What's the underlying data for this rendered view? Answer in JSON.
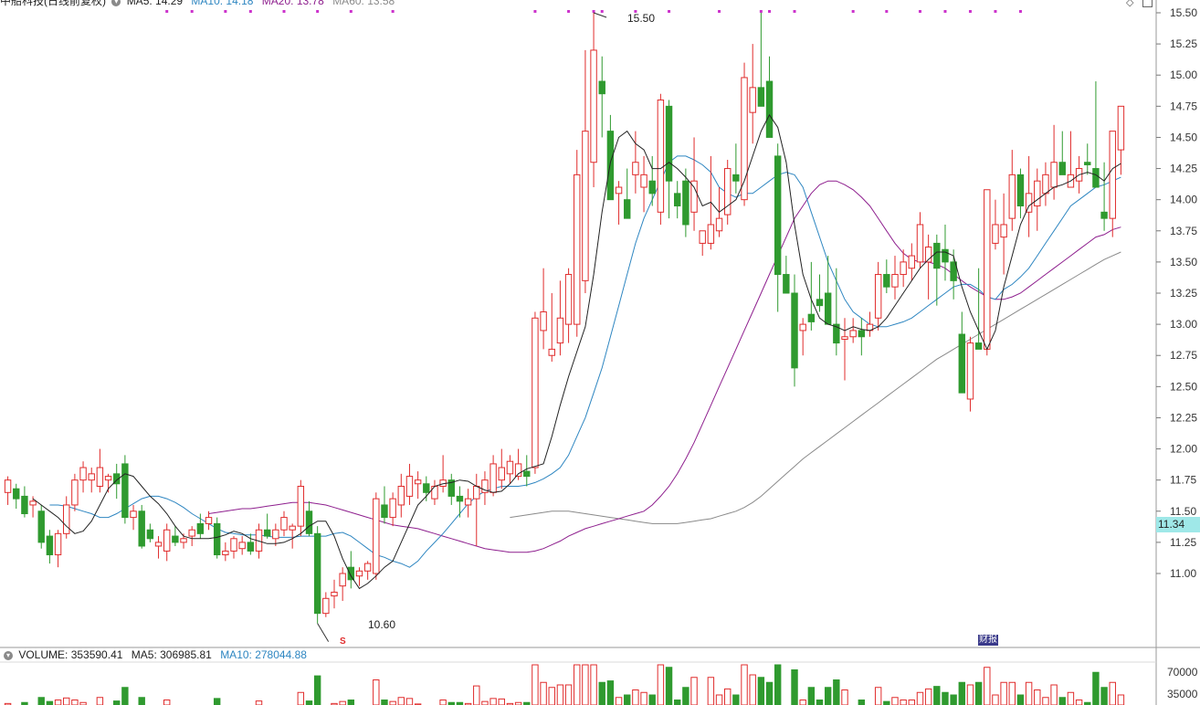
{
  "header": {
    "stock_title": "中船科技(日线前复权)",
    "ma5_label": "MA5: 14.29",
    "ma10_label": "MA10: 14.18",
    "ma20_label": "MA20: 13.78",
    "ma60_label": "MA60: 13.58"
  },
  "colors": {
    "up": "#e02c2c",
    "down": "#2f9a2f",
    "ma5": "#222222",
    "ma10": "#2e86c1",
    "ma20": "#8e1f8e",
    "ma60": "#8a8a8a",
    "marker": "#cc33cc",
    "price_badge_bg": "#9fe8e8"
  },
  "price_axis": {
    "ticks": [
      "15.50",
      "15.25",
      "15.00",
      "14.75",
      "14.50",
      "14.25",
      "14.00",
      "13.75",
      "13.50",
      "13.25",
      "13.00",
      "12.75",
      "12.50",
      "12.25",
      "12.00",
      "11.75",
      "11.50",
      "11.25",
      "11.00"
    ],
    "current_price": "11.34"
  },
  "annotations": {
    "high_label": "15.50",
    "low_label": "10.60",
    "event_marker_s": "S",
    "event_marker_cb": "财报"
  },
  "volume_panel": {
    "volume_label": "VOLUME: 353590.41",
    "ma5_label": "MA5: 306985.81",
    "ma10_label": "MA10: 278044.88",
    "ticks": [
      "70000",
      "35000"
    ]
  },
  "chart_data": {
    "type": "candlestick",
    "title": "中船科技(日线前复权)",
    "ylim": [
      10.4,
      15.62
    ],
    "ohlc": [
      [
        11.65,
        11.78,
        11.55,
        11.75
      ],
      [
        11.68,
        11.72,
        11.52,
        11.6
      ],
      [
        11.62,
        11.7,
        11.45,
        11.48
      ],
      [
        11.55,
        11.62,
        11.45,
        11.58
      ],
      [
        11.5,
        11.55,
        11.2,
        11.25
      ],
      [
        11.3,
        11.35,
        11.08,
        11.15
      ],
      [
        11.15,
        11.35,
        11.05,
        11.32
      ],
      [
        11.32,
        11.62,
        11.28,
        11.55
      ],
      [
        11.55,
        11.8,
        11.5,
        11.75
      ],
      [
        11.75,
        11.9,
        11.65,
        11.85
      ],
      [
        11.75,
        11.85,
        11.65,
        11.8
      ],
      [
        11.7,
        12.0,
        11.65,
        11.85
      ],
      [
        11.75,
        11.8,
        11.65,
        11.78
      ],
      [
        11.8,
        11.88,
        11.6,
        11.72
      ],
      [
        11.88,
        11.95,
        11.4,
        11.45
      ],
      [
        11.45,
        11.55,
        11.35,
        11.5
      ],
      [
        11.5,
        11.55,
        11.2,
        11.22
      ],
      [
        11.35,
        11.4,
        11.25,
        11.28
      ],
      [
        11.22,
        11.3,
        11.12,
        11.25
      ],
      [
        11.18,
        11.4,
        11.1,
        11.35
      ],
      [
        11.3,
        11.38,
        11.22,
        11.25
      ],
      [
        11.25,
        11.32,
        11.2,
        11.28
      ],
      [
        11.3,
        11.38,
        11.22,
        11.35
      ],
      [
        11.4,
        11.48,
        11.28,
        11.32
      ],
      [
        11.4,
        11.5,
        11.35,
        11.45
      ],
      [
        11.4,
        11.45,
        11.12,
        11.15
      ],
      [
        11.15,
        11.25,
        11.1,
        11.18
      ],
      [
        11.18,
        11.3,
        11.12,
        11.28
      ],
      [
        11.2,
        11.3,
        11.15,
        11.25
      ],
      [
        11.25,
        11.32,
        11.15,
        11.18
      ],
      [
        11.18,
        11.4,
        11.12,
        11.35
      ],
      [
        11.35,
        11.48,
        11.28,
        11.3
      ],
      [
        11.28,
        11.4,
        11.22,
        11.35
      ],
      [
        11.35,
        11.5,
        11.3,
        11.45
      ],
      [
        11.35,
        11.4,
        11.2,
        11.38
      ],
      [
        11.38,
        11.75,
        11.3,
        11.7
      ],
      [
        11.5,
        11.58,
        11.3,
        11.32
      ],
      [
        11.32,
        11.38,
        10.6,
        10.68
      ],
      [
        10.68,
        10.85,
        10.65,
        10.8
      ],
      [
        10.82,
        10.95,
        10.72,
        10.85
      ],
      [
        10.9,
        11.05,
        10.78,
        11.0
      ],
      [
        11.05,
        11.18,
        10.88,
        10.95
      ],
      [
        10.98,
        11.05,
        10.9,
        11.02
      ],
      [
        11.02,
        11.1,
        10.95,
        11.08
      ],
      [
        11.0,
        11.65,
        10.95,
        11.6
      ],
      [
        11.55,
        11.7,
        11.4,
        11.45
      ],
      [
        11.45,
        11.65,
        11.38,
        11.6
      ],
      [
        11.55,
        11.8,
        11.45,
        11.7
      ],
      [
        11.62,
        11.88,
        11.55,
        11.78
      ],
      [
        11.72,
        11.82,
        11.6,
        11.75
      ],
      [
        11.72,
        11.78,
        11.58,
        11.65
      ],
      [
        11.6,
        11.75,
        11.55,
        11.7
      ],
      [
        11.7,
        11.95,
        11.65,
        11.75
      ],
      [
        11.75,
        11.8,
        11.55,
        11.62
      ],
      [
        11.62,
        11.7,
        11.45,
        11.58
      ],
      [
        11.55,
        11.68,
        11.45,
        11.6
      ],
      [
        11.6,
        11.8,
        11.22,
        11.7
      ],
      [
        11.65,
        11.82,
        11.55,
        11.75
      ],
      [
        11.65,
        11.95,
        11.62,
        11.88
      ],
      [
        11.75,
        12.0,
        11.68,
        11.85
      ],
      [
        11.8,
        11.95,
        11.72,
        11.9
      ],
      [
        11.78,
        12.0,
        11.75,
        11.88
      ],
      [
        11.82,
        11.95,
        11.7,
        11.78
      ],
      [
        11.85,
        13.1,
        11.8,
        13.05
      ],
      [
        12.95,
        13.45,
        12.8,
        13.1
      ],
      [
        12.75,
        13.25,
        12.7,
        12.8
      ],
      [
        12.85,
        13.35,
        12.75,
        13.05
      ],
      [
        13.0,
        13.45,
        12.85,
        13.4
      ],
      [
        13.0,
        14.4,
        12.9,
        14.2
      ],
      [
        13.35,
        15.2,
        13.25,
        14.55
      ],
      [
        14.3,
        15.5,
        14.1,
        15.2
      ],
      [
        14.95,
        15.15,
        14.5,
        14.85
      ],
      [
        14.55,
        14.68,
        14.0,
        14.0
      ],
      [
        14.05,
        14.15,
        13.8,
        14.1
      ],
      [
        14.0,
        14.25,
        13.85,
        13.85
      ],
      [
        14.2,
        14.55,
        14.05,
        14.3
      ],
      [
        14.1,
        14.35,
        13.9,
        14.2
      ],
      [
        14.15,
        14.35,
        13.95,
        14.05
      ],
      [
        13.9,
        14.85,
        13.8,
        14.8
      ],
      [
        14.75,
        14.8,
        13.85,
        14.15
      ],
      [
        14.05,
        14.15,
        13.85,
        13.95
      ],
      [
        14.15,
        14.25,
        13.7,
        13.8
      ],
      [
        13.9,
        14.5,
        13.75,
        14.15
      ],
      [
        13.65,
        13.75,
        13.55,
        13.75
      ],
      [
        13.65,
        14.35,
        13.6,
        13.8
      ],
      [
        13.75,
        14.1,
        13.7,
        13.85
      ],
      [
        13.88,
        14.32,
        13.8,
        14.25
      ],
      [
        14.2,
        14.45,
        14.05,
        14.15
      ],
      [
        14.0,
        15.1,
        13.95,
        14.98
      ],
      [
        14.7,
        15.25,
        14.45,
        14.9
      ],
      [
        14.9,
        15.5,
        14.75,
        14.75
      ],
      [
        14.95,
        15.15,
        14.5,
        14.5
      ],
      [
        14.35,
        14.45,
        13.1,
        13.4
      ],
      [
        13.4,
        13.55,
        13.35,
        13.25
      ],
      [
        13.25,
        13.4,
        12.5,
        12.65
      ],
      [
        12.95,
        13.05,
        12.75,
        13.0
      ],
      [
        13.08,
        13.5,
        12.95,
        13.02
      ],
      [
        13.2,
        13.4,
        13.1,
        13.15
      ],
      [
        13.25,
        13.55,
        13.0,
        13.0
      ],
      [
        13.0,
        13.45,
        12.75,
        12.85
      ],
      [
        12.88,
        13.05,
        12.55,
        12.9
      ],
      [
        12.9,
        13.05,
        12.85,
        12.95
      ],
      [
        12.95,
        13.05,
        12.75,
        12.9
      ],
      [
        12.95,
        13.1,
        12.9,
        13.0
      ],
      [
        13.05,
        13.5,
        12.95,
        13.4
      ],
      [
        13.4,
        13.52,
        13.25,
        13.3
      ],
      [
        13.3,
        13.55,
        13.2,
        13.4
      ],
      [
        13.4,
        13.6,
        13.3,
        13.5
      ],
      [
        13.45,
        13.65,
        13.35,
        13.55
      ],
      [
        13.5,
        13.9,
        13.45,
        13.8
      ],
      [
        13.5,
        13.72,
        13.2,
        13.62
      ],
      [
        13.65,
        13.72,
        13.15,
        13.45
      ],
      [
        13.6,
        13.8,
        13.35,
        13.5
      ],
      [
        13.5,
        13.6,
        13.2,
        13.35
      ],
      [
        12.92,
        13.1,
        12.45,
        12.45
      ],
      [
        12.4,
        12.9,
        12.3,
        12.85
      ],
      [
        12.85,
        13.45,
        12.8,
        12.8
      ],
      [
        12.8,
        13.7,
        12.75,
        14.08
      ],
      [
        13.65,
        14.0,
        13.6,
        13.8
      ],
      [
        13.7,
        14.05,
        13.4,
        13.8
      ],
      [
        13.85,
        14.4,
        13.75,
        14.2
      ],
      [
        14.2,
        14.25,
        13.85,
        13.95
      ],
      [
        13.9,
        14.35,
        13.7,
        14.05
      ],
      [
        13.95,
        14.25,
        13.75,
        14.15
      ],
      [
        14.05,
        14.3,
        13.95,
        14.2
      ],
      [
        14.1,
        14.6,
        14.0,
        14.3
      ],
      [
        14.3,
        14.55,
        14.2,
        14.2
      ],
      [
        14.1,
        14.55,
        14.1,
        14.2
      ],
      [
        14.15,
        14.35,
        14.05,
        14.25
      ],
      [
        14.3,
        14.45,
        14.2,
        14.28
      ],
      [
        14.25,
        14.95,
        14.1,
        14.1
      ],
      [
        13.9,
        14.3,
        13.75,
        13.85
      ],
      [
        13.85,
        14.35,
        13.7,
        14.55
      ],
      [
        14.4,
        14.6,
        14.2,
        14.75
      ]
    ],
    "ma5": [
      11.6,
      11.55,
      11.5,
      11.45,
      11.38,
      11.32,
      11.34,
      11.42,
      11.55,
      11.68,
      11.75,
      11.8,
      11.78,
      11.7,
      11.62,
      11.56,
      11.48,
      11.38,
      11.3,
      11.28,
      11.28,
      11.28,
      11.29,
      11.31,
      11.34,
      11.32,
      11.28,
      11.26,
      11.24,
      11.24,
      11.25,
      11.28,
      11.32,
      11.38,
      11.42,
      11.42,
      11.3,
      11.12,
      10.98,
      10.88,
      10.92,
      10.98,
      11.05,
      11.1,
      11.25,
      11.4,
      11.55,
      11.62,
      11.7,
      11.72,
      11.73,
      11.75,
      11.74,
      11.7,
      11.67,
      11.65,
      11.66,
      11.72,
      11.8,
      11.84,
      11.86,
      11.88,
      12.1,
      12.35,
      12.58,
      12.78,
      12.98,
      13.4,
      13.9,
      14.3,
      14.5,
      14.55,
      14.45,
      14.4,
      14.25,
      14.25,
      14.3,
      14.25,
      14.18,
      14.1,
      13.95,
      13.98,
      13.9,
      13.95,
      14.0,
      14.15,
      14.35,
      14.55,
      14.68,
      14.58,
      14.3,
      13.8,
      13.4,
      13.2,
      13.05,
      13.0,
      12.98,
      12.95,
      12.98,
      12.96,
      12.95,
      12.98,
      13.05,
      13.15,
      13.25,
      13.35,
      13.45,
      13.52,
      13.58,
      13.58,
      13.55,
      13.3,
      13.1,
      12.95,
      12.8,
      12.95,
      13.3,
      13.55,
      13.8,
      13.95,
      14.0,
      14.05,
      14.1,
      14.12,
      14.15,
      14.2,
      14.22,
      14.2,
      14.15,
      14.25,
      14.29
    ],
    "ma10": [
      11.55,
      11.55,
      11.54,
      11.52,
      11.5,
      11.48,
      11.45,
      11.45,
      11.48,
      11.52,
      11.56,
      11.6,
      11.62,
      11.62,
      11.6,
      11.57,
      11.53,
      11.48,
      11.44,
      11.4,
      11.36,
      11.33,
      11.32,
      11.31,
      11.31,
      11.31,
      11.3,
      11.29,
      11.29,
      11.29,
      11.3,
      11.3,
      11.3,
      11.3,
      11.32,
      11.33,
      11.3,
      11.25,
      11.2,
      11.15,
      11.13,
      11.1,
      11.08,
      11.05,
      11.1,
      11.18,
      11.25,
      11.32,
      11.4,
      11.48,
      11.56,
      11.62,
      11.66,
      11.68,
      11.7,
      11.7,
      11.7,
      11.71,
      11.73,
      11.76,
      11.8,
      11.85,
      11.95,
      12.1,
      12.25,
      12.45,
      12.65,
      12.9,
      13.15,
      13.4,
      13.65,
      13.85,
      14.0,
      14.15,
      14.3,
      14.35,
      14.35,
      14.32,
      14.28,
      14.22,
      14.1,
      14.05,
      14.02,
      14.05,
      14.05,
      14.1,
      14.15,
      14.2,
      14.22,
      14.2,
      14.1,
      13.9,
      13.7,
      13.5,
      13.35,
      13.2,
      13.1,
      13.05,
      13.0,
      12.98,
      12.98,
      13.0,
      13.02,
      13.05,
      13.1,
      13.15,
      13.2,
      13.25,
      13.3,
      13.32,
      13.32,
      13.28,
      13.22,
      13.2,
      13.28,
      13.32,
      13.38,
      13.45,
      13.55,
      13.65,
      13.75,
      13.85,
      13.95,
      14.0,
      14.05,
      14.1,
      14.12,
      14.15,
      14.18
    ],
    "ma20": [
      11.48,
      11.49,
      11.5,
      11.51,
      11.52,
      11.52,
      11.53,
      11.54,
      11.55,
      11.56,
      11.57,
      11.57,
      11.57,
      11.56,
      11.55,
      11.53,
      11.51,
      11.49,
      11.47,
      11.45,
      11.43,
      11.41,
      11.39,
      11.38,
      11.37,
      11.36,
      11.34,
      11.32,
      11.3,
      11.28,
      11.26,
      11.24,
      11.22,
      11.2,
      11.19,
      11.18,
      11.17,
      11.17,
      11.17,
      11.18,
      11.2,
      11.23,
      11.26,
      11.3,
      11.33,
      11.36,
      11.38,
      11.4,
      11.42,
      11.44,
      11.46,
      11.48,
      11.5,
      11.55,
      11.62,
      11.7,
      11.8,
      11.92,
      12.05,
      12.2,
      12.35,
      12.5,
      12.65,
      12.8,
      12.95,
      13.1,
      13.25,
      13.4,
      13.55,
      13.7,
      13.85,
      13.95,
      14.05,
      14.12,
      14.15,
      14.15,
      14.12,
      14.08,
      14.02,
      13.95,
      13.85,
      13.75,
      13.65,
      13.57,
      13.52,
      13.5,
      13.5,
      13.48,
      13.45,
      13.4,
      13.35,
      13.3,
      13.26,
      13.22,
      13.2,
      13.2,
      13.22,
      13.25,
      13.3,
      13.35,
      13.4,
      13.45,
      13.5,
      13.55,
      13.6,
      13.65,
      13.7,
      13.72,
      13.76,
      13.78
    ],
    "ma60": [
      11.45,
      11.46,
      11.47,
      11.48,
      11.49,
      11.5,
      11.5,
      11.5,
      11.49,
      11.48,
      11.47,
      11.46,
      11.45,
      11.44,
      11.43,
      11.42,
      11.41,
      11.4,
      11.4,
      11.4,
      11.4,
      11.41,
      11.42,
      11.43,
      11.44,
      11.46,
      11.48,
      11.5,
      11.53,
      11.57,
      11.62,
      11.68,
      11.74,
      11.8,
      11.86,
      11.92,
      11.97,
      12.02,
      12.07,
      12.12,
      12.17,
      12.22,
      12.27,
      12.32,
      12.37,
      12.42,
      12.47,
      12.52,
      12.57,
      12.62,
      12.67,
      12.72,
      12.76,
      12.8,
      12.84,
      12.88,
      12.92,
      12.96,
      13.0,
      13.04,
      13.08,
      13.12,
      13.16,
      13.2,
      13.24,
      13.28,
      13.32,
      13.36,
      13.4,
      13.44,
      13.48,
      13.52,
      13.55,
      13.58
    ]
  }
}
